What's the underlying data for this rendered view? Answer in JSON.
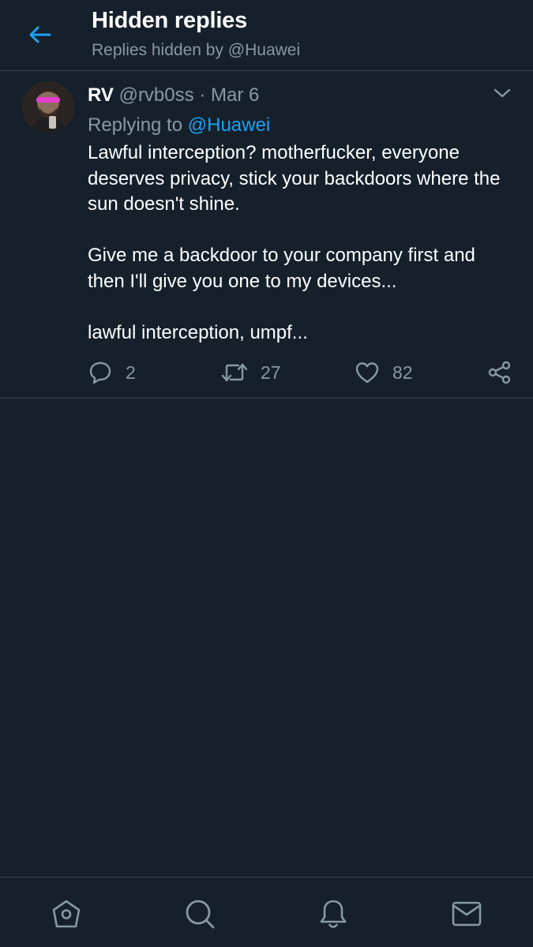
{
  "header": {
    "title": "Hidden replies",
    "subtitle": "Replies hidden by @Huawei"
  },
  "tweet": {
    "author_name": "RV",
    "author_handle": "@rvb0ss",
    "separator": "·",
    "date": "Mar 6",
    "replying_to_label": "Replying to",
    "replying_to_handle": "@Huawei",
    "paragraphs": [
      "Lawful interception? motherfucker, everyone deserves privacy, stick your backdoors where the sun doesn't shine.",
      "Give me a backdoor to your company first and then I'll give you one to my devices...",
      "lawful interception, umpf..."
    ],
    "stats": {
      "replies": "2",
      "retweets": "27",
      "likes": "82"
    }
  },
  "icons": {
    "back": "arrow-left-icon",
    "more": "chevron-down-icon",
    "reply": "speech-bubble-icon",
    "retweet": "retweet-icon",
    "like": "heart-icon",
    "share": "share-icon",
    "home": "home-icon",
    "search": "search-icon",
    "notifications": "bell-icon",
    "messages": "envelope-icon"
  },
  "colors": {
    "background": "#15202b",
    "accent": "#1da1f2",
    "secondary_text": "#8899a6",
    "divider": "#38444d"
  }
}
